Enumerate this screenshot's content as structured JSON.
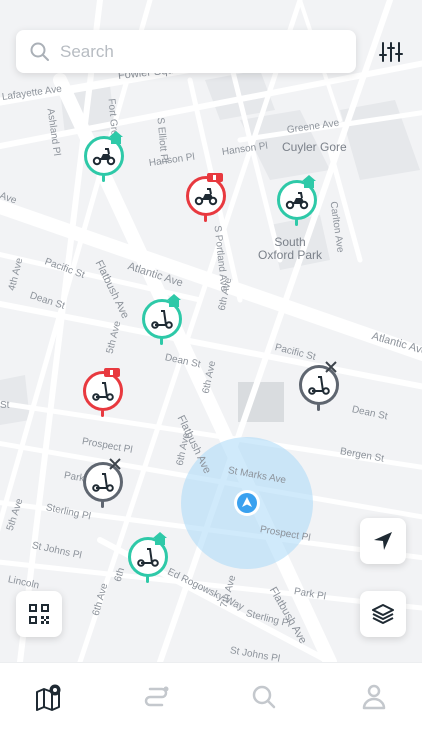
{
  "search": {
    "placeholder": "Search"
  },
  "filter_icon": "sliders-icon",
  "map": {
    "streets": [
      {
        "id": "fowler",
        "text": "Fowler Square"
      },
      {
        "id": "lafayette",
        "text": "Lafayette Ave"
      },
      {
        "id": "ashland",
        "text": "Ashland Pl"
      },
      {
        "id": "fortgreene",
        "text": "Fort Greene Pl"
      },
      {
        "id": "selliott",
        "text": "S Elliott Pl"
      },
      {
        "id": "hanson1",
        "text": "Hanson Pl"
      },
      {
        "id": "hanson2",
        "text": "Hanson Pl"
      },
      {
        "id": "greene",
        "text": "Greene Ave"
      },
      {
        "id": "cuyler",
        "text": "Cuyler Gore"
      },
      {
        "id": "carlton",
        "text": "Carlton Ave"
      },
      {
        "id": "ave_left",
        "text": "Ave"
      },
      {
        "id": "sportland",
        "text": "S Portland Ave"
      },
      {
        "id": "pacific1",
        "text": "Pacific St"
      },
      {
        "id": "fourth",
        "text": "4th Ave"
      },
      {
        "id": "dean1",
        "text": "Dean St"
      },
      {
        "id": "flatbush1",
        "text": "Flatbush Ave"
      },
      {
        "id": "atlantic1",
        "text": "Atlantic Ave"
      },
      {
        "id": "atlantic2",
        "text": "Atlantic Ave"
      },
      {
        "id": "sixth1",
        "text": "6th Ave"
      },
      {
        "id": "pacific2",
        "text": "Pacific St"
      },
      {
        "id": "fifth1",
        "text": "5th Ave"
      },
      {
        "id": "dean2",
        "text": "Dean St"
      },
      {
        "id": "sixth2",
        "text": "6th Ave"
      },
      {
        "id": "dean3",
        "text": "Dean St"
      },
      {
        "id": "st_left",
        "text": "St"
      },
      {
        "id": "flatbush2",
        "text": "Flatbush Ave"
      },
      {
        "id": "prospect1",
        "text": "Prospect Pl"
      },
      {
        "id": "bergen",
        "text": "Bergen St"
      },
      {
        "id": "sixth3",
        "text": "6th Ave"
      },
      {
        "id": "stmarks",
        "text": "St Marks Ave"
      },
      {
        "id": "park",
        "text": "Park"
      },
      {
        "id": "sterling1",
        "text": "Sterling Pl"
      },
      {
        "id": "fifth2",
        "text": "5th Ave"
      },
      {
        "id": "prospect2",
        "text": "Prospect Pl"
      },
      {
        "id": "stjohns1",
        "text": "St Johns Pl"
      },
      {
        "id": "edrogowsky",
        "text": "Ed Rogowsky Way"
      },
      {
        "id": "lincoln",
        "text": "Lincoln"
      },
      {
        "id": "sixth4",
        "text": "6th"
      },
      {
        "id": "sixth5",
        "text": "6th Ave"
      },
      {
        "id": "seventh",
        "text": "7th Ave"
      },
      {
        "id": "sterling2",
        "text": "Sterling Pl"
      },
      {
        "id": "flatbush3",
        "text": "Flatbush Ave"
      },
      {
        "id": "parkpl",
        "text": "Park Pl"
      },
      {
        "id": "stjohns2",
        "text": "St Johns Pl"
      }
    ],
    "places": [
      {
        "id": "south_oxford",
        "text": "South\nOxford Park"
      }
    ],
    "colors": {
      "available": "#2ec9a8",
      "low_battery": "#e8393f",
      "maintenance": "#5f6670",
      "location": "#3aa1ef"
    }
  },
  "pins": [
    {
      "name": "scooter-pin-1",
      "vehicle": "moped",
      "status": "available",
      "badge": "home-icon"
    },
    {
      "name": "scooter-pin-2",
      "vehicle": "moped",
      "status": "low_battery",
      "badge": "battery-low-icon"
    },
    {
      "name": "scooter-pin-3",
      "vehicle": "moped",
      "status": "available",
      "badge": "home-icon"
    },
    {
      "name": "scooter-pin-4",
      "vehicle": "kick-scooter",
      "status": "available",
      "badge": "home-icon"
    },
    {
      "name": "scooter-pin-5",
      "vehicle": "kick-scooter",
      "status": "low_battery",
      "badge": "battery-low-icon"
    },
    {
      "name": "scooter-pin-6",
      "vehicle": "kick-scooter",
      "status": "maintenance",
      "badge": "wrench-icon"
    },
    {
      "name": "scooter-pin-7",
      "vehicle": "kick-scooter",
      "status": "maintenance",
      "badge": "wrench-icon"
    },
    {
      "name": "scooter-pin-8",
      "vehicle": "kick-scooter",
      "status": "available",
      "badge": "home-icon"
    }
  ],
  "map_buttons": [
    "location-arrow-icon",
    "layers-icon",
    "qr-code-icon"
  ],
  "tabbar": [
    {
      "name": "tab-map",
      "icon": "map-pin-icon",
      "active": true
    },
    {
      "name": "tab-routes",
      "icon": "route-icon",
      "active": false
    },
    {
      "name": "tab-search",
      "icon": "search-icon",
      "active": false
    },
    {
      "name": "tab-profile",
      "icon": "user-icon",
      "active": false
    }
  ]
}
